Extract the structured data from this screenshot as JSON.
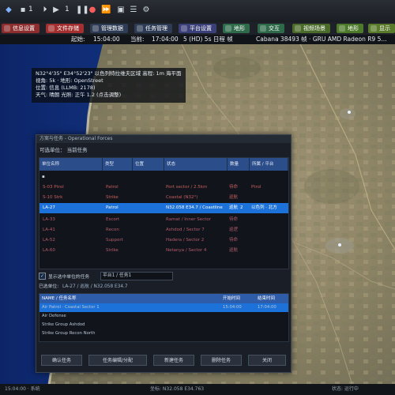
{
  "toolbar": {
    "time_value": "1",
    "speed_value": "1",
    "icons": [
      "app-icon",
      "stop-icon",
      "step-icon",
      "play-icon",
      "pause-icon",
      "record-icon",
      "fast-forward-icon",
      "camera-icon",
      "layers-icon",
      "mesh-icon",
      "gear-icon"
    ]
  },
  "tabs": [
    {
      "label": "信息设置",
      "color": "#8e2d2d"
    },
    {
      "label": "文件存储",
      "color": "#a33030"
    },
    {
      "label": "管理数据",
      "color": "#2d3b55"
    },
    {
      "label": "任务管理",
      "color": "#2d3b55"
    },
    {
      "label": "平台设置",
      "color": "#3b3f78"
    },
    {
      "label": "地形",
      "color": "#2e6a4a"
    },
    {
      "label": "交互",
      "color": "#2e6a4a"
    },
    {
      "label": "视频场景",
      "color": "#4b6b2a"
    },
    {
      "label": "地形",
      "color": "#4c7a2a"
    },
    {
      "label": "显示",
      "color": "#587a2a"
    }
  ],
  "statusline": {
    "start_label": "起始:",
    "start_time": "15:04:00",
    "current_label": "当前:",
    "current_time": "17:04:00",
    "mode": "5 (HD) 5s 日程 帧",
    "extra": "Cabana 38493 帧 · GRU AMD Radeon R9 5..."
  },
  "map_info": {
    "line1": "N32°4'35\" E34°52'23\" 以色列特拉维夫区域  高程: 1m 海平面",
    "line2": "视角:  5k  · 地形: OpenStreet",
    "line3": "位置: 信息  (LLMB: 2178)",
    "line4": "天气: 晴朗  光照: 正午   1.2  (点击调整)"
  },
  "dialog": {
    "title": "方案与任务 - Operational Forces",
    "subtitle": "可选单位：  当前任务",
    "table_headers": [
      "单位名称",
      "类型",
      "位置",
      "状态",
      "数量",
      "所属 / 平台"
    ],
    "rows": [
      {
        "name": "▪",
        "type": "",
        "pos": "",
        "status": "",
        "qty": "",
        "owner": ""
      },
      {
        "name": "   S-03 Ptrol",
        "type": "Patrol",
        "pos": "Port sector / 2.5km",
        "status": "待命",
        "qty": "1",
        "owner": "Ptrol"
      },
      {
        "name": "   S-10 Strk",
        "type": "Strike",
        "pos": "Coastal (N32°)",
        "status": "巡航",
        "qty": "3",
        "owner": ""
      },
      {
        "name": "   LA-27",
        "type": "Patrol",
        "pos": "N32.058 E34.7 / Coastline",
        "status": "巡航",
        "qty": "2",
        "owner": "以色列 · 北方"
      },
      {
        "name": "   LA-33",
        "type": "Escort",
        "pos": "Ramat / Inner Sector",
        "status": "待命",
        "qty": "4",
        "owner": ""
      },
      {
        "name": "   LA-41",
        "type": "Recon",
        "pos": "Ashdod / Sector 7",
        "status": "巡逻",
        "qty": "2",
        "owner": ""
      },
      {
        "name": "   LA-52",
        "type": "Support",
        "pos": "Hadera / Sector 2",
        "status": "待命",
        "qty": "1",
        "owner": ""
      },
      {
        "name": "   LA-60",
        "type": "Strike",
        "pos": "Netanya / Sector 4",
        "status": "巡航",
        "qty": "3",
        "owner": ""
      }
    ],
    "options": {
      "check_label": "显示选中单位的任务",
      "dropdown_value": "平台1 / 任务1",
      "selected_label": "已选单位:",
      "selected_value": "LA-27 / 巡航 / N32.058 E34.7"
    },
    "sub_headers": [
      "NAME / 任务名称",
      "开始时间",
      "结束时间"
    ],
    "sub_rows": [
      {
        "name": "Air Patrol · Coastal Sector 1",
        "start": "15:04:00",
        "end": "17:04:00"
      },
      {
        "name": "Air Defense",
        "start": "",
        "end": ""
      },
      {
        "name": "Strike Group Ashdod",
        "start": "",
        "end": ""
      },
      {
        "name": "Strike Group Recon North",
        "start": "",
        "end": ""
      }
    ],
    "buttons": [
      "确认任务",
      "任务编辑/分配",
      "新建任务",
      "删除任务",
      "关闭"
    ]
  },
  "bottombar": {
    "left": "15:04:00 · 系统",
    "mid": "坐标: N32.058  E34.763",
    "right": "状态: 运行中"
  }
}
